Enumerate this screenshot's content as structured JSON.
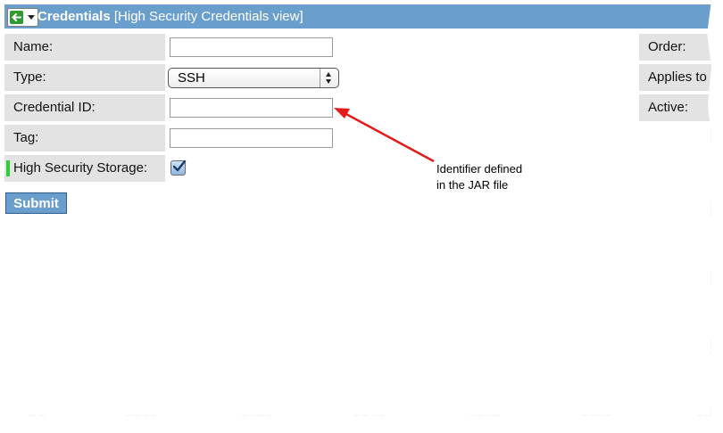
{
  "titlebar": {
    "title": "Credentials",
    "view": "[High Security Credentials view]",
    "back_icon": "back-arrow-icon",
    "dropdown_icon": "chevron-down-icon"
  },
  "form": {
    "name_label": "Name:",
    "name_value": "",
    "type_label": "Type:",
    "type_value": "SSH",
    "credential_id_label": "Credential ID:",
    "credential_id_value": "",
    "tag_label": "Tag:",
    "tag_value": "",
    "high_security_label": "High Security Storage:",
    "high_security_checked": true,
    "submit_label": "Submit"
  },
  "right_column": {
    "order_label": "Order:",
    "applies_label": "Applies to",
    "active_label": "Active:"
  },
  "annotation": {
    "line1": "Identifier defined",
    "line2": "in the JAR file",
    "arrow_color": "#e51b1b"
  },
  "colors": {
    "titlebar": "#6a9fcd",
    "label_bg": "#e3e3e3",
    "accent_green": "#2fcf3a"
  }
}
